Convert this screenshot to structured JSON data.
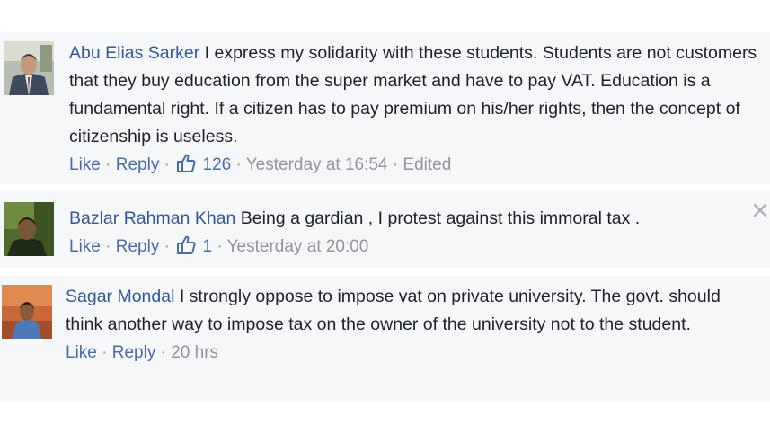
{
  "comments": [
    {
      "author": "Abu Elias Sarker",
      "text": "I express my solidarity with these students. Students are not customers that they buy education from the super market and have to pay VAT. Education is a fundamental right. If a citizen has to pay premium on his/her rights, then the concept of citizenship is useless.",
      "like_label": "Like",
      "reply_label": "Reply",
      "like_count": "126",
      "timestamp": "Yesterday at 16:54",
      "edited_label": "Edited"
    },
    {
      "author": "Bazlar Rahman Khan",
      "text": "Being a gardian , I protest against this immoral tax .",
      "like_label": "Like",
      "reply_label": "Reply",
      "like_count": "1",
      "timestamp": "Yesterday at 20:00"
    },
    {
      "author": "Sagar Mondal",
      "text": "I strongly oppose to impose vat on private university. The govt. should think another way to impose tax on the owner of the university not to the student.",
      "like_label": "Like",
      "reply_label": "Reply",
      "timestamp": "20 hrs"
    }
  ],
  "icons": {
    "like": "thumbs-up-icon",
    "close": "close-icon"
  },
  "colors": {
    "author": "#365899",
    "action_link": "#4b6aa8",
    "meta": "#90949c",
    "text": "#1d2129",
    "comment_bg": "#f6f7f9"
  }
}
